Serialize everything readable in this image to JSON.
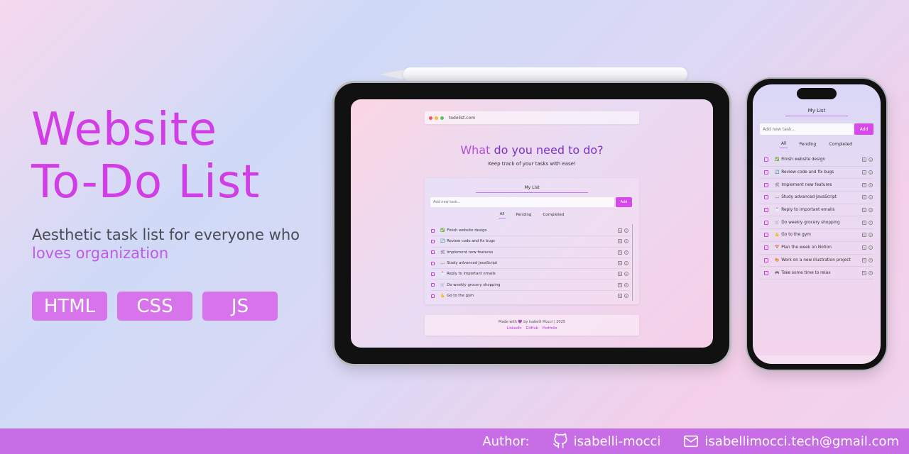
{
  "hero": {
    "title_line1": "Website",
    "title_line2": "To-Do List",
    "subtitle": "Aesthetic task list for everyone who",
    "subtitle_accent": "loves organization",
    "tags": [
      "HTML",
      "CSS",
      "JS"
    ]
  },
  "footer": {
    "author_label": "Author:",
    "github_handle": "isabelli-mocci",
    "email": "isabellimocci.tech@gmail.com"
  },
  "colors": {
    "accent": "#d23ee6",
    "tag_bg": "#d774ec",
    "footer_bg": "#c76de6",
    "add_button": "#d54ae8"
  },
  "tablet": {
    "url": "todolist.com",
    "heading_part1": "What",
    "heading_part2": "do you need to do?",
    "subheading": "Keep track of your tasks with ease!",
    "card_title": "My List",
    "input_placeholder": "Add new task...",
    "add_label": "Add",
    "filters": [
      "All",
      "Pending",
      "Completed"
    ],
    "tasks": [
      {
        "emoji": "✅",
        "text": "Finish website design"
      },
      {
        "emoji": "🔄",
        "text": "Review code and fix bugs"
      },
      {
        "emoji": "🛠",
        "text": "Implement new features"
      },
      {
        "emoji": "📖",
        "text": "Study advanced JavaScript"
      },
      {
        "emoji": "📩",
        "text": "Reply to important emails"
      },
      {
        "emoji": "🛒",
        "text": "Do weekly grocery shopping"
      },
      {
        "emoji": "💪",
        "text": "Go to the gym"
      }
    ],
    "footer_made": "Made with 💜 by Isabelli Mocci | 2025",
    "footer_links": [
      "LinkedIn",
      "GitHub",
      "Portfolio"
    ]
  },
  "phone": {
    "card_title": "My List",
    "input_placeholder": "Add new task...",
    "add_label": "Add",
    "filters": [
      "All",
      "Pending",
      "Completed"
    ],
    "tasks": [
      {
        "emoji": "✅",
        "text": "Finish website design"
      },
      {
        "emoji": "🔄",
        "text": "Review code and fix bugs"
      },
      {
        "emoji": "🛠",
        "text": "Implement new features"
      },
      {
        "emoji": "📖",
        "text": "Study advanced JavaScript"
      },
      {
        "emoji": "📩",
        "text": "Reply to important emails"
      },
      {
        "emoji": "🛒",
        "text": "Do weekly grocery shopping"
      },
      {
        "emoji": "💪",
        "text": "Go to the gym"
      },
      {
        "emoji": "📅",
        "text": "Plan the week on Notion"
      },
      {
        "emoji": "🎨",
        "text": "Work on a new illustration project"
      },
      {
        "emoji": "🎮",
        "text": "Take some time to relax"
      }
    ]
  }
}
